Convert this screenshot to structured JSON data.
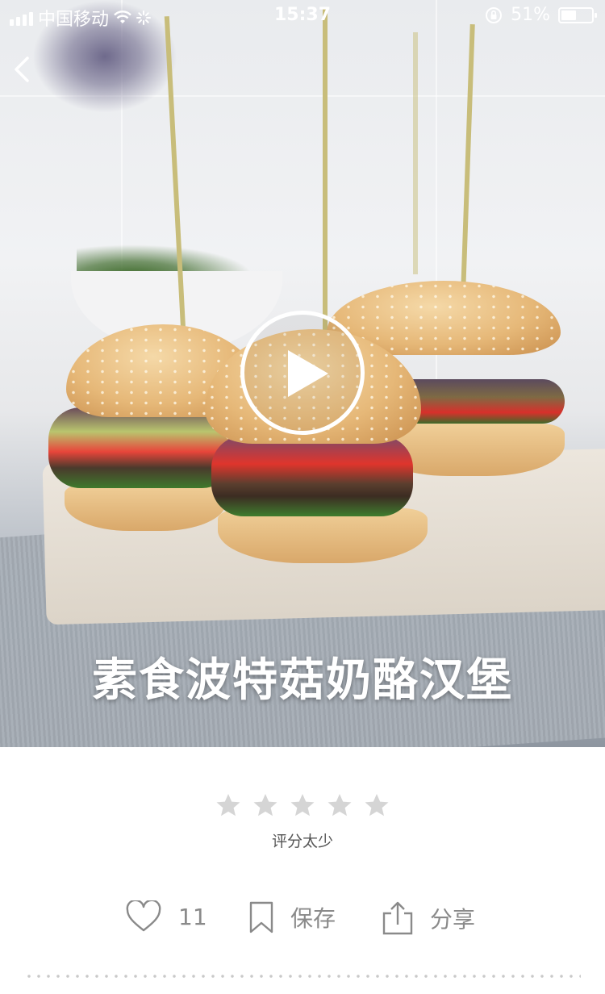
{
  "status_bar": {
    "carrier": "中国移动",
    "time": "15:37",
    "battery": "51%",
    "battery_level": 0.51
  },
  "recipe": {
    "title": "素食波特菇奶酪汉堡",
    "rating_stars_filled": 0,
    "rating_stars_total": 5,
    "rating_text": "评分太少"
  },
  "actions": {
    "like_count": "11",
    "save_label": "保存",
    "share_label": "分享"
  },
  "icons": {
    "back": "chevron-left-icon",
    "play": "play-icon",
    "like": "heart-icon",
    "save": "bookmark-icon",
    "share": "share-icon"
  },
  "colors": {
    "star_empty": "#d5d5d5",
    "action_text": "#8a8a8a"
  }
}
